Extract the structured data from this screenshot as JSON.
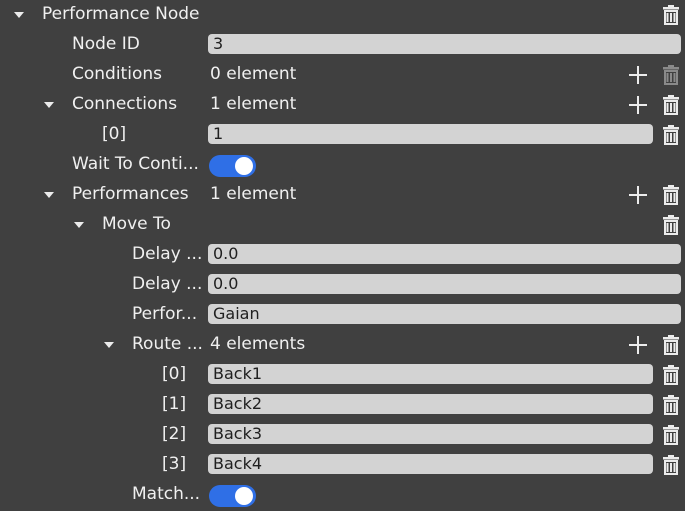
{
  "root": {
    "label": "Performance Node"
  },
  "node_id": {
    "label": "Node ID",
    "value": "3"
  },
  "conditions": {
    "label": "Conditions",
    "summary": "0 element"
  },
  "connections": {
    "label": "Connections",
    "summary": "1 element",
    "items": [
      {
        "index": "[0]",
        "value": "1"
      }
    ]
  },
  "wait_to_continue": {
    "label": "Wait To Conti...",
    "enabled": true
  },
  "performances": {
    "label": "Performances",
    "summary": "1 element",
    "move_to": {
      "label": "Move To",
      "delay_1": {
        "label": "Delay ...",
        "value": "0.0"
      },
      "delay_2": {
        "label": "Delay ...",
        "value": "0.0"
      },
      "performer": {
        "label": "Perfor...",
        "value": "Gaian"
      },
      "route": {
        "label": "Route ...",
        "summary": "4 elements",
        "items": [
          {
            "index": "[0]",
            "value": "Back1"
          },
          {
            "index": "[1]",
            "value": "Back2"
          },
          {
            "index": "[2]",
            "value": "Back3"
          },
          {
            "index": "[3]",
            "value": "Back4"
          }
        ]
      },
      "match": {
        "label": "Match...",
        "enabled": true
      }
    }
  },
  "colors": {
    "background": "#404040",
    "field": "#d3d3d3",
    "toggle_on": "#2f6fe6",
    "icon": "#ececec",
    "icon_disabled": "#8a8a8a"
  }
}
